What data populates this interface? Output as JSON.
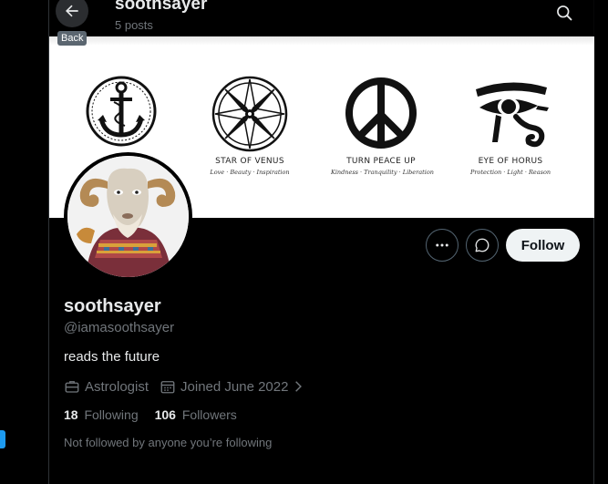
{
  "header": {
    "title": "soothsayer",
    "post_count": "5 posts",
    "back_tooltip": "Back",
    "icons": {
      "back": "arrow-left-icon",
      "search": "search-icon"
    }
  },
  "banner": {
    "symbols": [
      {
        "name": "",
        "subtitle": "",
        "icon": "anchor-icon"
      },
      {
        "name": "STAR OF VENUS",
        "subtitle": "Love · Beauty · Inspiration",
        "icon": "star-of-venus-icon"
      },
      {
        "name": "TURN PEACE UP",
        "subtitle": "Kindness · Tranquility · Liberation",
        "icon": "peace-sign-icon"
      },
      {
        "name": "EYE OF HORUS",
        "subtitle": "Protection · Light · Reason",
        "icon": "eye-of-horus-icon"
      }
    ]
  },
  "actions": {
    "more_icon": "more-icon",
    "message_icon": "message-icon",
    "follow_label": "Follow"
  },
  "profile": {
    "display_name": "soothsayer",
    "handle": "@iamasoothsayer",
    "bio": "reads the future",
    "profession": "Astrologist",
    "joined": "Joined June 2022",
    "following_count": "18",
    "following_label": "Following",
    "followers_count": "106",
    "followers_label": "Followers",
    "not_followed_text": "Not followed by anyone you’re following"
  },
  "colors": {
    "background": "#000000",
    "text_primary": "#e7e9ea",
    "text_secondary": "#71767b",
    "border": "#2f3336",
    "follow_bg": "#eff3f4",
    "accent": "#1d9bf0"
  }
}
